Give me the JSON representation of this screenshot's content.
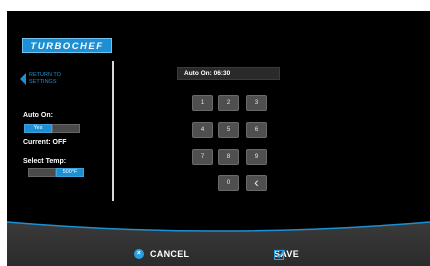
{
  "brand": {
    "logo_text": "TURBOCHEF"
  },
  "left_panel": {
    "back_label": "RETURN TO SETTINGS",
    "auto_on_label": "Auto On:",
    "auto_on_toggle": [
      {
        "label": "Yes",
        "active": true
      },
      {
        "label": "",
        "active": false
      }
    ],
    "current_label": "Current: OFF",
    "select_temp_label": "Select Temp:",
    "temp_toggle": [
      {
        "label": "",
        "active": false
      },
      {
        "label": "500°F",
        "active": true
      }
    ]
  },
  "display": {
    "text": "Auto On:  06:30"
  },
  "keypad": {
    "keys": [
      "1",
      "2",
      "3",
      "4",
      "5",
      "6",
      "7",
      "8",
      "9",
      "0"
    ],
    "backspace_glyph": "‹"
  },
  "footer": {
    "cancel_label": "CANCEL",
    "save_label": "SAVE"
  },
  "colors": {
    "accent": "#1d8fd2",
    "background": "#000000",
    "key": "#4f4f4f"
  }
}
